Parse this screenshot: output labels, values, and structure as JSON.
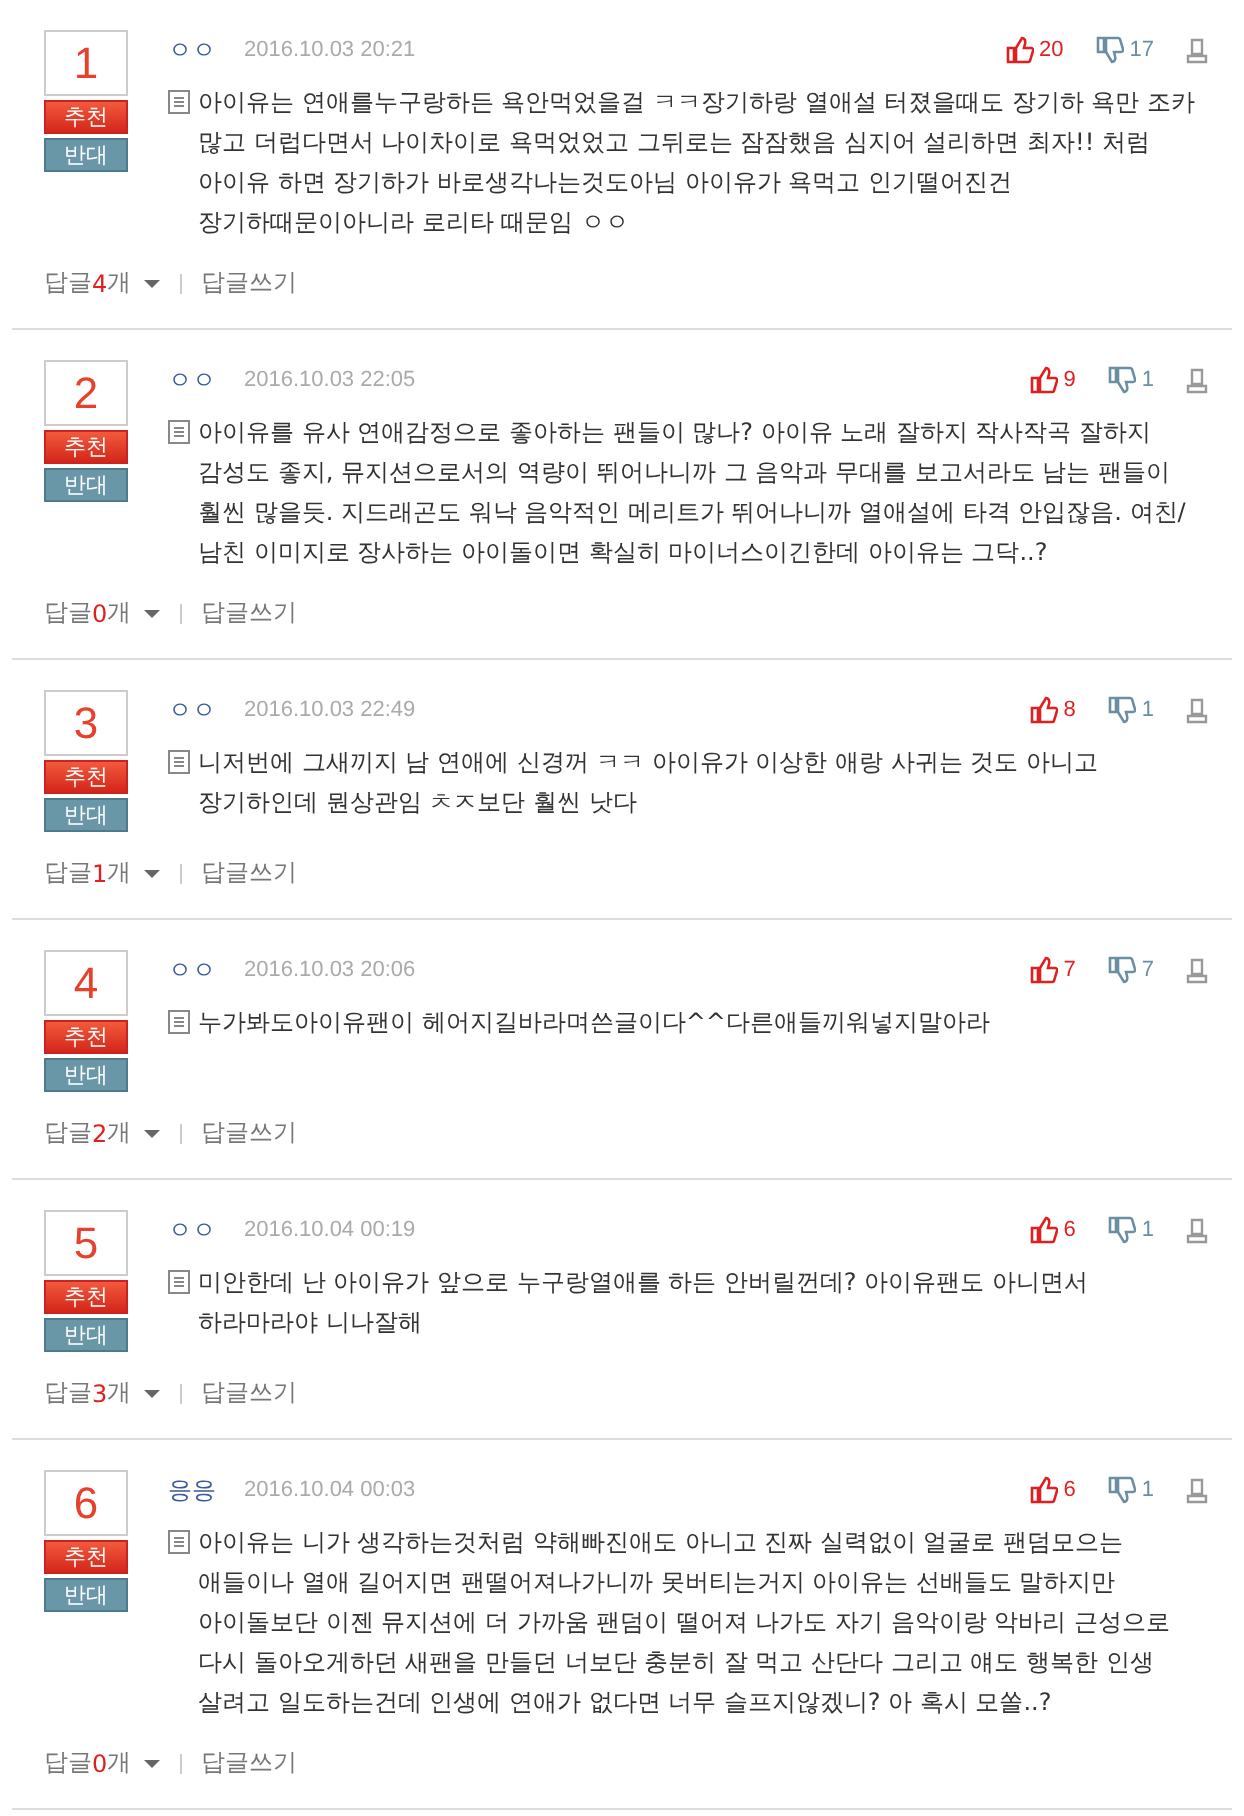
{
  "comments": [
    {
      "rank": "1",
      "author": "ㅇㅇ",
      "date": "2016.10.03 20:21",
      "likes": "20",
      "dislikes": "17",
      "recommend": "추천",
      "oppose": "반대",
      "text": "아이유는 연애를누구랑하든 욕안먹었을걸 ㅋㅋ장기하랑 열애설 터졌을때도 장기하 욕만 조카 많고 더럽다면서 나이차이로 욕먹었었고 그뒤로는 잠잠했음 심지어 설리하면 최자!! 처럼 아이유 하면 장기하가 바로생각나는것도아님 아이유가 욕먹고 인기떨어진건 장기하때문이아니라 로리타 때문임 ㅇㅇ",
      "reply_label": "답글",
      "reply_count": "4",
      "reply_unit": "개",
      "write_reply": "답글쓰기"
    },
    {
      "rank": "2",
      "author": "ㅇㅇ",
      "date": "2016.10.03 22:05",
      "likes": "9",
      "dislikes": "1",
      "recommend": "추천",
      "oppose": "반대",
      "text": "아이유를 유사 연애감정으로 좋아하는 팬들이 많나? 아이유 노래 잘하지 작사작곡 잘하지 감성도 좋지, 뮤지션으로서의 역량이 뛰어나니까 그 음악과 무대를 보고서라도 남는 팬들이 훨씬 많을듯. 지드래곤도 워낙 음악적인 메리트가 뛰어나니까 열애설에 타격 안입잖음. 여친/남친 이미지로 장사하는 아이돌이면 확실히 마이너스이긴한데 아이유는 그닥..?",
      "reply_label": "답글",
      "reply_count": "0",
      "reply_unit": "개",
      "write_reply": "답글쓰기"
    },
    {
      "rank": "3",
      "author": "ㅇㅇ",
      "date": "2016.10.03 22:49",
      "likes": "8",
      "dislikes": "1",
      "recommend": "추천",
      "oppose": "반대",
      "text": "니저번에 그새끼지 남 연애에 신경꺼 ㅋㅋ 아이유가 이상한 애랑 사귀는 것도 아니고 장기하인데 뭔상관임 ㅊㅈ보단 훨씬 낫다",
      "reply_label": "답글",
      "reply_count": "1",
      "reply_unit": "개",
      "write_reply": "답글쓰기"
    },
    {
      "rank": "4",
      "author": "ㅇㅇ",
      "date": "2016.10.03 20:06",
      "likes": "7",
      "dislikes": "7",
      "recommend": "추천",
      "oppose": "반대",
      "text": "누가봐도아이유팬이 헤어지길바라며쓴글이다^^다른애들끼워넣지말아라",
      "reply_label": "답글",
      "reply_count": "2",
      "reply_unit": "개",
      "write_reply": "답글쓰기"
    },
    {
      "rank": "5",
      "author": "ㅇㅇ",
      "date": "2016.10.04 00:19",
      "likes": "6",
      "dislikes": "1",
      "recommend": "추천",
      "oppose": "반대",
      "text": "미안한데 난 아이유가 앞으로 누구랑열애를 하든 안버릴껀데? 아이유팬도 아니면서 하라마라야 니나잘해",
      "reply_label": "답글",
      "reply_count": "3",
      "reply_unit": "개",
      "write_reply": "답글쓰기"
    },
    {
      "rank": "6",
      "author": "응응",
      "date": "2016.10.04 00:03",
      "likes": "6",
      "dislikes": "1",
      "recommend": "추천",
      "oppose": "반대",
      "text": "아이유는 니가 생각하는것처럼 약해빠진애도 아니고 진짜 실력없이 얼굴로 팬덤모으는 애들이나 열애 길어지면 팬떨어져나가니까 못버티는거지 아이유는 선배들도 말하지만 아이돌보단 이젠 뮤지션에 더 가까움 팬덤이 떨어져 나가도 자기 음악이랑 악바리 근성으로 다시 돌아오게하던 새팬을 만들던 너보단 충분히 잘 먹고 산단다 그리고 얘도 행복한 인생 살려고 일도하는건데 인생에 연애가 없다면 너무 슬프지않겠니? 아 혹시 모쏠..?",
      "reply_label": "답글",
      "reply_count": "0",
      "reply_unit": "개",
      "write_reply": "답글쓰기"
    }
  ]
}
